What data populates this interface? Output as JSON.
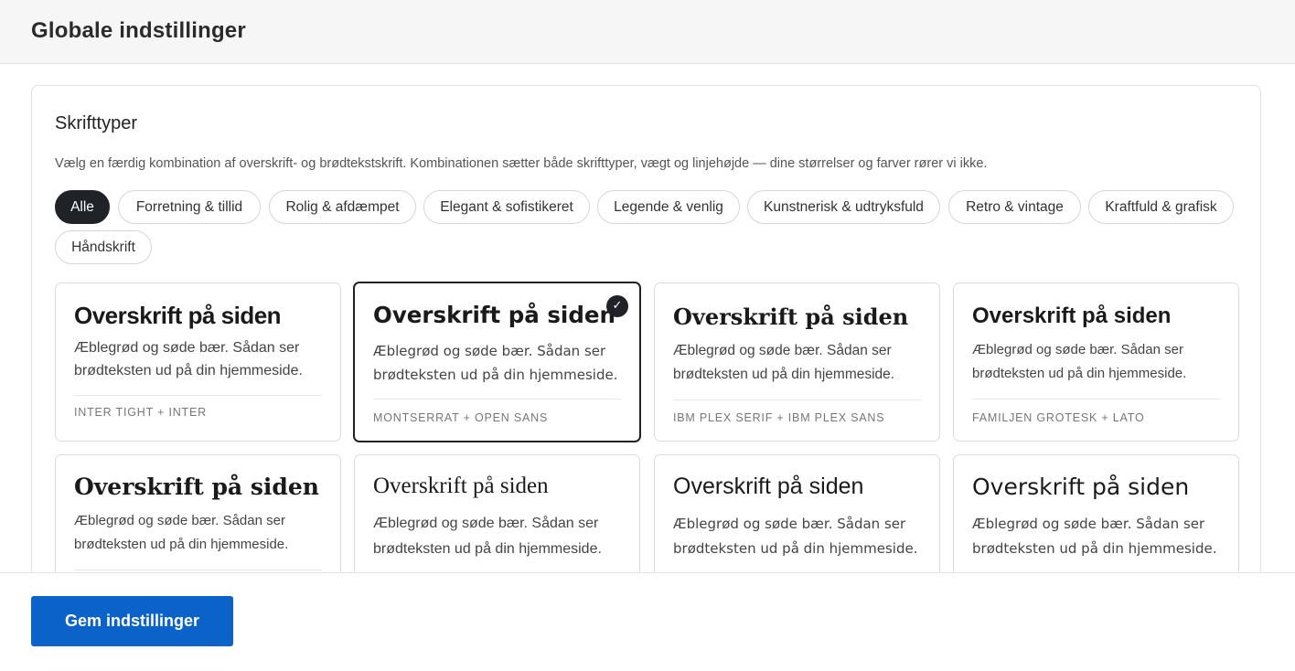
{
  "header": {
    "title": "Globale indstillinger"
  },
  "fonts_section": {
    "title": "Skrifttyper",
    "description": "Vælg en færdig kombination af overskrift- og brødtekstskrift. Kombinationen sætter både skrifttyper, vægt og linjehøjde — dine størrelser og farver rører vi ikke."
  },
  "filters": [
    {
      "label": "Alle",
      "active": true
    },
    {
      "label": "Forretning & tillid"
    },
    {
      "label": "Rolig & afdæmpet"
    },
    {
      "label": "Elegant & sofistikeret"
    },
    {
      "label": "Legende & venlig"
    },
    {
      "label": "Kunstnerisk & udtryksfuld"
    },
    {
      "label": "Retro & vintage"
    },
    {
      "label": "Kraftfuld & grafisk"
    },
    {
      "label": "Håndskrift"
    }
  ],
  "cards": [
    {
      "heading": "Overskrift på siden",
      "body": "Æblegrød og søde bær. Sådan ser brødteksten ud på din hjemmeside.",
      "label": "INTER TIGHT + INTER"
    },
    {
      "heading": "Overskrift på siden",
      "body": "Æblegrød og søde bær. Sådan ser brødteksten ud på din hjemmeside.",
      "label": "MONTSERRAT + OPEN SANS",
      "selected": true,
      "check": "✓"
    },
    {
      "heading": "Overskrift på siden",
      "body": "Æblegrød og søde bær. Sådan ser brødteksten ud på din hjemmeside.",
      "label": "IBM PLEX SERIF + IBM PLEX SANS"
    },
    {
      "heading": "Overskrift på siden",
      "body": "Æblegrød og søde bær. Sådan ser brødteksten ud på din hjemmeside.",
      "label": "FAMILJEN GROTESK + LATO"
    },
    {
      "heading": "Overskrift på siden",
      "body": "Æblegrød og søde bær. Sådan ser brødteksten ud på din hjemmeside."
    },
    {
      "heading": "Overskrift på siden",
      "body": "Æblegrød og søde bær. Sådan ser brødteksten ud på din hjemmeside."
    },
    {
      "heading": "Overskrift på siden",
      "body": "Æblegrød og søde bær. Sådan ser brødteksten ud på din hjemmeside."
    },
    {
      "heading": "Overskrift på siden",
      "body": "Æblegrød og søde bær. Sådan ser brødteksten ud på din hjemmeside."
    }
  ],
  "footer": {
    "save_label": "Gem indstillinger"
  },
  "colors": {
    "accent": "#0b62c9",
    "dark": "#1f2328",
    "border": "#dcdcdc"
  }
}
